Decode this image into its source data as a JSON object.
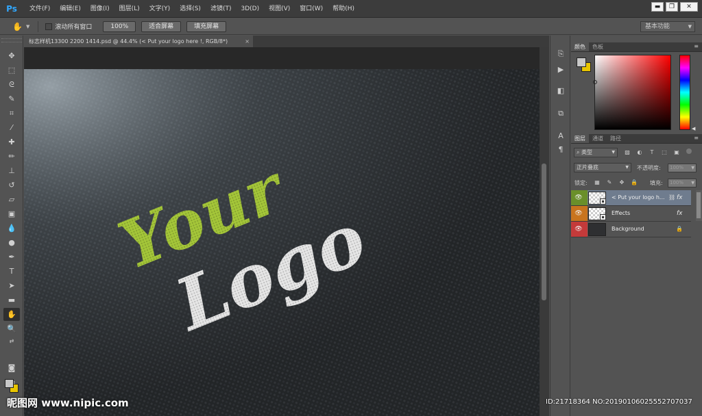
{
  "app": {
    "logo": "Ps"
  },
  "menu": [
    "文件(F)",
    "编辑(E)",
    "图像(I)",
    "图层(L)",
    "文字(Y)",
    "选择(S)",
    "滤镜(T)",
    "3D(D)",
    "视图(V)",
    "窗口(W)",
    "帮助(H)"
  ],
  "window_controls": {
    "minimize": "▬",
    "restore": "❐",
    "close": "✕"
  },
  "options_bar": {
    "scroll_all_label": "滚动所有窗口",
    "btn_100": "100%",
    "btn_fit": "适合屏幕",
    "btn_fill": "填充屏幕",
    "workspace": "基本功能"
  },
  "document": {
    "tab_title": "标志样机13300 2200 1414.psd @ 44.4% (< Put your logo here !, RGB/8*)",
    "close": "×",
    "artwork": {
      "line1": "Your",
      "line2": "Logo"
    }
  },
  "tools": [
    "move",
    "marquee",
    "lasso",
    "quick-select",
    "crop",
    "eyedropper",
    "healing",
    "brush",
    "clone-stamp",
    "history-brush",
    "eraser",
    "gradient",
    "blur",
    "dodge",
    "pen",
    "type",
    "path-select",
    "shape",
    "hand",
    "zoom"
  ],
  "panels": {
    "color_tabs": [
      "颜色",
      "色板"
    ],
    "layers_tabs": [
      "图层",
      "通道",
      "路径"
    ],
    "filter_kind": "类型",
    "blend_mode": "正片叠底",
    "opacity_label": "不透明度:",
    "opacity_value": "100%",
    "lock_label": "锁定:",
    "fill_label": "填充:",
    "fill_value": "100%",
    "layers": [
      {
        "name": "< Put your logo h...",
        "fx": "fx",
        "eye_color": "#6a8f2a",
        "selected": true
      },
      {
        "name": "Effects",
        "fx": "fx",
        "eye_color": "#c8741e",
        "selected": false
      },
      {
        "name": "Background",
        "fx": "",
        "eye_color": "#c43a3a",
        "selected": false
      }
    ]
  },
  "watermark": {
    "left": "昵图网 www.nipic.com",
    "right": "ID:21718364 NO:20190106025552707037"
  },
  "colors": {
    "accent": "#31a8ff",
    "logo_green": "#a4c639",
    "logo_white": "#e6e6e6",
    "fg_swatch": "#c8c8c8",
    "bg_swatch": "#e8c500"
  }
}
